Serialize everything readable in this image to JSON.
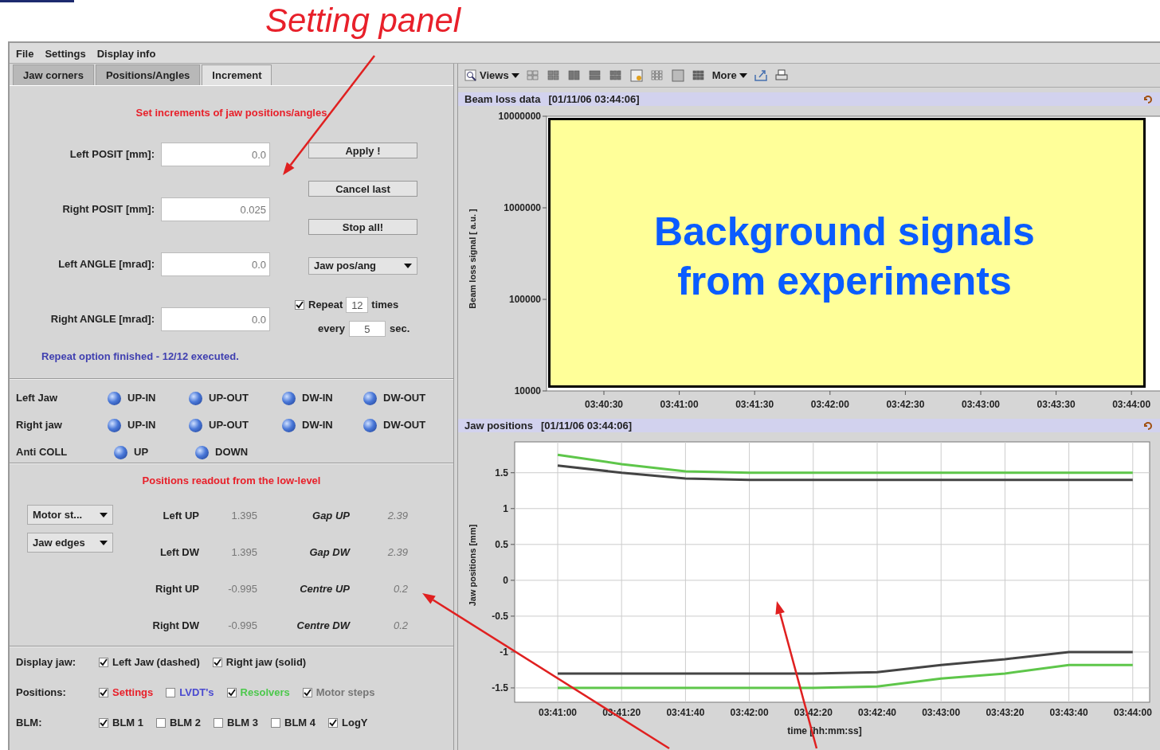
{
  "annotation": {
    "title": "Setting panel"
  },
  "menu": [
    "File",
    "Settings",
    "Display info"
  ],
  "tabs": [
    {
      "label": "Jaw corners",
      "selected": false
    },
    {
      "label": "Positions/Angles",
      "selected": false
    },
    {
      "label": "Increment",
      "selected": true
    }
  ],
  "increment": {
    "title": "Set increments of jaw positions/angles",
    "fields": [
      {
        "label": "Left POSIT [mm]:",
        "value": "0.0"
      },
      {
        "label": "Right POSIT [mm]:",
        "value": "0.025"
      },
      {
        "label": "Left ANGLE [mrad]:",
        "value": "0.0"
      },
      {
        "label": "Right ANGLE [mrad]:",
        "value": "0.0"
      }
    ],
    "buttons": [
      "Apply !",
      "Cancel last",
      "Stop all!"
    ],
    "mode_dropdown": "Jaw pos/ang",
    "repeat": {
      "label": "Repeat",
      "checked": true,
      "count": "12",
      "times_label": "times",
      "every_label": "every",
      "interval": "5",
      "unit": "sec."
    },
    "status": "Repeat option finished - 12/12 executed."
  },
  "jaw_controls": [
    {
      "label": "Left Jaw",
      "buttons": [
        "UP-IN",
        "UP-OUT",
        "DW-IN",
        "DW-OUT"
      ]
    },
    {
      "label": "Right jaw",
      "buttons": [
        "UP-IN",
        "UP-OUT",
        "DW-IN",
        "DW-OUT"
      ]
    },
    {
      "label": "Anti COLL",
      "buttons": [
        "UP",
        "DOWN"
      ]
    }
  ],
  "readout": {
    "title": "Positions readout from the low-level",
    "dropdowns": [
      "Motor st...",
      "Jaw edges"
    ],
    "rows": [
      {
        "label": "Left UP",
        "value": "1.395",
        "label2": "Gap UP",
        "value2": "2.39"
      },
      {
        "label": "Left DW",
        "value": "1.395",
        "label2": "Gap DW",
        "value2": "2.39"
      },
      {
        "label": "Right UP",
        "value": "-0.995",
        "label2": "Centre UP",
        "value2": "0.2"
      },
      {
        "label": "Right DW",
        "value": "-0.995",
        "label2": "Centre DW",
        "value2": "0.2"
      }
    ]
  },
  "display_options": [
    {
      "label": "Display jaw:",
      "options": [
        {
          "label": "Left Jaw (dashed)",
          "checked": true
        },
        {
          "label": "Right jaw (solid)",
          "checked": true
        }
      ]
    },
    {
      "label": "Positions:",
      "options": [
        {
          "label": "Settings",
          "checked": true,
          "color": "#e8202a"
        },
        {
          "label": "LVDT's",
          "checked": false,
          "color": "#4a4ad0"
        },
        {
          "label": "Resolvers",
          "checked": true,
          "color": "#4cc84c"
        },
        {
          "label": "Motor steps",
          "checked": true,
          "color": "#777777"
        }
      ]
    },
    {
      "label": "BLM:",
      "options": [
        {
          "label": "BLM 1",
          "checked": true
        },
        {
          "label": "BLM 2",
          "checked": false
        },
        {
          "label": "BLM 3",
          "checked": false
        },
        {
          "label": "BLM 4",
          "checked": false
        },
        {
          "label": "LogY",
          "checked": true
        }
      ]
    }
  ],
  "toolbar": {
    "views": "Views",
    "more": "More"
  },
  "beam_loss": {
    "title": "Beam loss data",
    "timestamp": "[01/11/06 03:44:06]",
    "ylabel": "Beam loss signal [ a.u. ]",
    "yticks": [
      "10000000",
      "1000000",
      "100000",
      "10000"
    ],
    "xticks": [
      "03:40:30",
      "03:41:00",
      "03:41:30",
      "03:42:00",
      "03:42:30",
      "03:43:00",
      "03:43:30",
      "03:44:00"
    ],
    "overlay": [
      "Background signals",
      "from experiments"
    ]
  },
  "jaw_positions": {
    "title": "Jaw positions",
    "timestamp": "[01/11/06 03:44:06]",
    "chart_data": {
      "type": "line",
      "xlabel": "time [hh:mm:ss]",
      "ylabel": "Jaw positions [mm]",
      "categories": [
        "03:41:00",
        "03:41:20",
        "03:41:40",
        "03:42:00",
        "03:42:20",
        "03:42:40",
        "03:43:00",
        "03:43:20",
        "03:43:40",
        "03:44:00"
      ],
      "series": [
        {
          "color": "#5ec64a",
          "values": [
            1.75,
            1.62,
            1.52,
            1.5,
            1.5,
            1.5,
            1.5,
            1.5,
            1.5,
            1.5
          ]
        },
        {
          "color": "#444444",
          "values": [
            1.6,
            1.5,
            1.42,
            1.4,
            1.4,
            1.4,
            1.4,
            1.4,
            1.4,
            1.4
          ]
        },
        {
          "color": "#444444",
          "values": [
            -1.3,
            -1.3,
            -1.3,
            -1.3,
            -1.3,
            -1.28,
            -1.18,
            -1.1,
            -1.0,
            -1.0
          ]
        },
        {
          "color": "#5ec64a",
          "values": [
            -1.5,
            -1.5,
            -1.5,
            -1.5,
            -1.5,
            -1.48,
            -1.37,
            -1.3,
            -1.18,
            -1.18
          ]
        }
      ],
      "ylim": [
        -1.7,
        1.93
      ],
      "grid": true,
      "yticks": [
        {
          "value": 1.5,
          "label": "1.5"
        },
        {
          "value": 1,
          "label": "1"
        },
        {
          "value": 0.5,
          "label": "0.5"
        },
        {
          "value": 0,
          "label": "0"
        },
        {
          "value": -0.5,
          "label": "-0.5"
        },
        {
          "value": -1,
          "label": "-1"
        },
        {
          "value": -1.5,
          "label": "-1.5"
        }
      ]
    }
  }
}
